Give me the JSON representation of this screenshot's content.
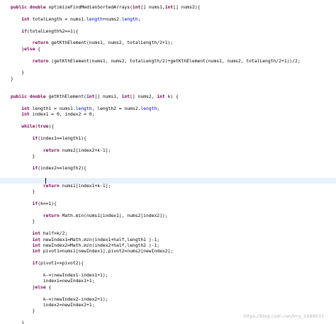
{
  "editor": {
    "lines": [
      [
        {
          "t": "public",
          "c": "kw"
        },
        {
          "t": " "
        },
        {
          "t": "double",
          "c": "kw"
        },
        {
          "t": " optimizeFindMedianSortedArrays("
        },
        {
          "t": "int",
          "c": "kw"
        },
        {
          "t": "[] nums1,"
        },
        {
          "t": "int",
          "c": "kw"
        },
        {
          "t": "[] nums2){"
        }
      ],
      [],
      [
        {
          "t": "    "
        },
        {
          "t": "int",
          "c": "kw"
        },
        {
          "t": " totalLength = nums1."
        },
        {
          "t": "length",
          "c": "fld"
        },
        {
          "t": "+nums2."
        },
        {
          "t": "length",
          "c": "fld"
        },
        {
          "t": ";"
        }
      ],
      [],
      [
        {
          "t": "    "
        },
        {
          "t": "if",
          "c": "kw"
        },
        {
          "t": "(totalLength%2==1){"
        }
      ],
      [],
      [
        {
          "t": "        "
        },
        {
          "t": "return",
          "c": "kw"
        },
        {
          "t": " getKthElement(nums1, nums2, totalLength/2+1);"
        }
      ],
      [
        {
          "t": "    }"
        },
        {
          "t": "else",
          "c": "kw"
        },
        {
          "t": " {"
        }
      ],
      [],
      [
        {
          "t": "        "
        },
        {
          "t": "return",
          "c": "kw"
        },
        {
          "t": " (getKthElement(nums1, nums2, totalLength/2)+getKthElement(nums1, nums2, totalLength/2+1))/2;"
        }
      ],
      [],
      [
        {
          "t": "    }"
        }
      ],
      [
        {
          "t": "}"
        }
      ],
      [],
      [],
      [
        {
          "t": "public",
          "c": "kw"
        },
        {
          "t": " "
        },
        {
          "t": "double",
          "c": "kw"
        },
        {
          "t": " getKthElement("
        },
        {
          "t": "int",
          "c": "kw"
        },
        {
          "t": "[] nums1, "
        },
        {
          "t": "int",
          "c": "kw"
        },
        {
          "t": "[] nums2, "
        },
        {
          "t": "int",
          "c": "kw"
        },
        {
          "t": " k) {"
        }
      ],
      [],
      [
        {
          "t": "    "
        },
        {
          "t": "int",
          "c": "kw"
        },
        {
          "t": " length1 = nums1."
        },
        {
          "t": "length",
          "c": "fld"
        },
        {
          "t": ", length2 = nums2."
        },
        {
          "t": "length",
          "c": "fld"
        },
        {
          "t": ";"
        }
      ],
      [
        {
          "t": "    "
        },
        {
          "t": "int",
          "c": "kw"
        },
        {
          "t": " index1 = 0, index2 = 0;"
        }
      ],
      [],
      [
        {
          "t": "    "
        },
        {
          "t": "while",
          "c": "kw"
        },
        {
          "t": "("
        },
        {
          "t": "true",
          "c": "kw"
        },
        {
          "t": "){"
        }
      ],
      [],
      [
        {
          "t": "        "
        },
        {
          "t": "if",
          "c": "kw"
        },
        {
          "t": "(index1==length1){"
        }
      ],
      [],
      [
        {
          "t": "            "
        },
        {
          "t": "return",
          "c": "kw"
        },
        {
          "t": " nums2[index2+k-1];"
        }
      ],
      [
        {
          "t": "        }"
        }
      ],
      [],
      [
        {
          "t": "        "
        },
        {
          "t": "if",
          "c": "kw"
        },
        {
          "t": "(index2==length2){"
        }
      ],
      [],
      [],
      [
        {
          "t": "            "
        },
        {
          "t": "return",
          "c": "kw"
        },
        {
          "t": " nums1[index1+k-1];"
        }
      ],
      [
        {
          "t": "        }"
        }
      ],
      [],
      [
        {
          "t": "        "
        },
        {
          "t": "if",
          "c": "kw"
        },
        {
          "t": "(k==1){"
        }
      ],
      [],
      [
        {
          "t": "            "
        },
        {
          "t": "return",
          "c": "kw"
        },
        {
          "t": " Math."
        },
        {
          "t": "min",
          "c": "it"
        },
        {
          "t": "(nums1[index1], nums2[index2]);"
        }
      ],
      [
        {
          "t": "        }"
        }
      ],
      [],
      [
        {
          "t": "        "
        },
        {
          "t": "int",
          "c": "kw"
        },
        {
          "t": " half=k/2;"
        }
      ],
      [
        {
          "t": "        "
        },
        {
          "t": "int",
          "c": "kw"
        },
        {
          "t": " newIndex1=Math."
        },
        {
          "t": "min",
          "c": "it"
        },
        {
          "t": "(index1+half,length1 )-1;"
        }
      ],
      [
        {
          "t": "        "
        },
        {
          "t": "int",
          "c": "kw"
        },
        {
          "t": " newIndex2=Math."
        },
        {
          "t": "min",
          "c": "it"
        },
        {
          "t": "(index2+half,length2 )-1;"
        }
      ],
      [
        {
          "t": "        "
        },
        {
          "t": "int",
          "c": "kw"
        },
        {
          "t": " pivot1=nums1[newIndex1],pivot2=nums2[newIndex2];"
        }
      ],
      [],
      [
        {
          "t": "        "
        },
        {
          "t": "if",
          "c": "kw"
        },
        {
          "t": "(pivot1<=pivot2){"
        }
      ],
      [],
      [
        {
          "t": "            k-=(newIndex1-index1+1);"
        }
      ],
      [
        {
          "t": "            index1=newIndex1+1;"
        }
      ],
      [
        {
          "t": "        }"
        },
        {
          "t": "else",
          "c": "kw"
        },
        {
          "t": " {"
        }
      ],
      [],
      [
        {
          "t": "            k-=(newIndex2-index2+1);"
        }
      ],
      [
        {
          "t": "            index2=newIndex2+1;"
        }
      ],
      [
        {
          "t": "        }"
        }
      ],
      [],
      [
        {
          "t": "    }"
        }
      ],
      [],
      [
        {
          "t": "}"
        }
      ]
    ],
    "current_line": 29,
    "watermark": "https://blog.csdn.net/lmy_1689031"
  },
  "colors": {
    "background": "#ffffff",
    "keyword": "#7f0055",
    "field": "#0000c0",
    "text": "#000000",
    "current_line": "#e8f2fe",
    "watermark": "#b9b9b9"
  }
}
